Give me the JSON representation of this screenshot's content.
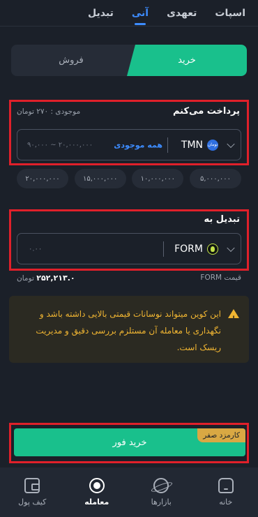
{
  "top_tabs": [
    "اسپات",
    "تعهدی",
    "آنی",
    "تبدیل"
  ],
  "active_tab": "آنی",
  "buysell": {
    "buy": "خرید",
    "sell": "فروش"
  },
  "pay": {
    "title": "پرداخت می‌کنم",
    "balance": "موجودی : ۲۷۰ تومان",
    "coin": "TMN",
    "coin_badge": "تومان",
    "all_balance": "همه موجودی",
    "placeholder": "۹۰,۰۰۰ ~ ۲۰,۰۰۰,۰۰۰"
  },
  "chips": [
    "۲۰,۰۰۰,۰۰۰",
    "۱۵,۰۰۰,۰۰۰",
    "۱۰,۰۰۰,۰۰۰",
    "۵,۰۰۰,۰۰۰"
  ],
  "convert": {
    "title": "تبدیل به",
    "coin": "FORM",
    "placeholder": "۰.۰۰"
  },
  "price": {
    "label": "قیمت FORM",
    "value": "۲۵۲,۲۱۳.۰",
    "unit": "تومان"
  },
  "warning": "این کوین میتواند نوسانات قیمتی بالایی داشته باشد و نگهداری یا معامله آن مستلزم بررسی دقیق و مدیریت ریسک است.",
  "buy_now": {
    "label": "خرید فور",
    "fee_badge": "کارمزد صفر"
  },
  "bottom_nav": [
    {
      "label": "خانه",
      "icon": "home-icon"
    },
    {
      "label": "بازارها",
      "icon": "market-icon"
    },
    {
      "label": "معامله",
      "icon": "trade-icon"
    },
    {
      "label": "کیف پول",
      "icon": "wallet-icon"
    }
  ],
  "colors": {
    "accent": "#19c08c",
    "link": "#3d8cff",
    "warning": "#f0b532",
    "highlight": "#e0202a"
  }
}
